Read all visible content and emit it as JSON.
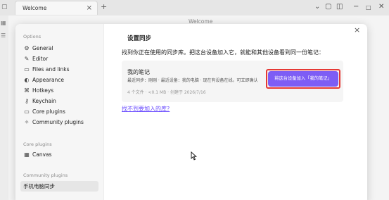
{
  "window": {
    "tab_title": "Welcome",
    "tab_close": "×",
    "new_tab": "+",
    "view_header_title": "Welcome"
  },
  "settings": {
    "options_heading": "Options",
    "options_items": [
      {
        "label": "General",
        "icon": "settings-icon"
      },
      {
        "label": "Editor",
        "icon": "pencil-icon"
      },
      {
        "label": "Files and links",
        "icon": "folder-icon"
      },
      {
        "label": "Appearance",
        "icon": "palette-icon"
      },
      {
        "label": "Hotkeys",
        "icon": "command-icon"
      },
      {
        "label": "Keychain",
        "icon": "key-icon"
      },
      {
        "label": "Core plugins",
        "icon": "plug-icon"
      },
      {
        "label": "Community plugins",
        "icon": "puzzle-icon"
      }
    ],
    "core_plugins_heading": "Core plugins",
    "core_plugins_items": [
      {
        "label": "Canvas",
        "icon": "canvas-icon"
      }
    ],
    "community_plugins_heading": "Community plugins",
    "community_plugins_items": [
      {
        "label": "手机电脑同步",
        "active": true
      }
    ]
  },
  "sync": {
    "title": "设置同步",
    "description": "找到你正在使用的同步库。把这台设备加入它，就能和其他设备看到同一份笔记：",
    "vault_name": "我的笔记",
    "vault_meta": "最近同步：刚刚 · 最近设备：我的电脑 · 现在有设备在线。可立即确认",
    "vault_stats": "4 个文件 · <0.1 MB · 创建于 2026/7/16",
    "add_button_label": "将这台设备加入「我的笔记」",
    "not_found_link": "找不到要加入的库?"
  },
  "colors": {
    "accent": "#7d5df5",
    "highlight": "#e53935",
    "link": "#6a4cff"
  }
}
